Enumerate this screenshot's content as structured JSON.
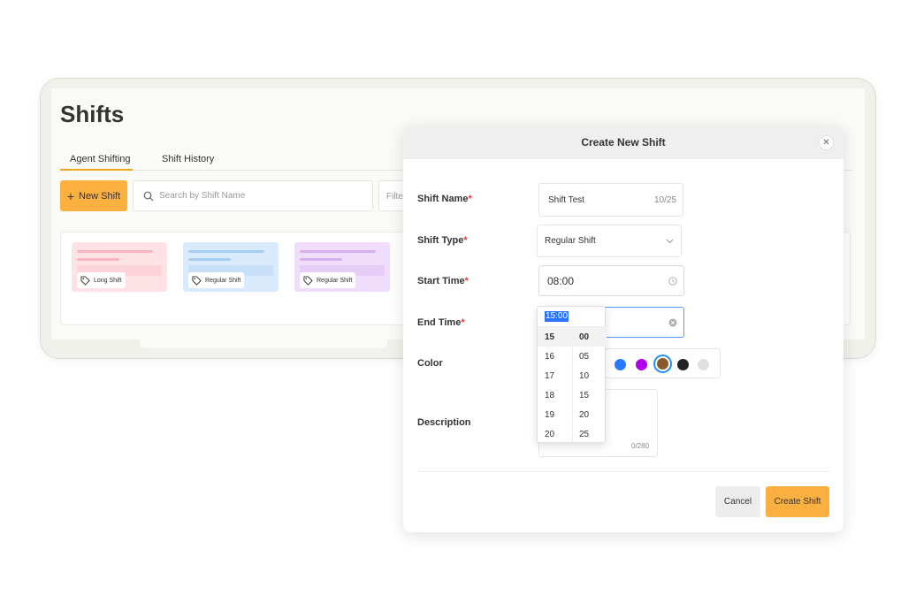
{
  "page": {
    "title": "Shifts",
    "tabs": [
      {
        "label": "Agent Shifting",
        "active": true
      },
      {
        "label": "Shift History",
        "active": false
      }
    ],
    "new_button": "New Shift",
    "search_placeholder": "Search by Shift Name",
    "filter_label": "Filter",
    "cards": [
      {
        "tag": "Long Shift",
        "color": "#ffe2e6"
      },
      {
        "tag": "Regular Shift",
        "color": "#d9eafc"
      },
      {
        "tag": "Regular Shift",
        "color": "#efddfb"
      }
    ]
  },
  "modal": {
    "title": "Create New Shift",
    "close_icon": "close-icon",
    "fields": {
      "shift_name": {
        "label": "Shift Name",
        "value": "Shift Test",
        "counter": "10/25"
      },
      "shift_type": {
        "label": "Shift Type",
        "value": "Regular Shift"
      },
      "start_time": {
        "label": "Start Time",
        "value": "08:00"
      },
      "end_time": {
        "label": "End Time",
        "value": "15:00"
      },
      "color": {
        "label": "Color",
        "swatches": [
          "#2979ff",
          "#b000f0",
          "#8a5a2b",
          "#222222",
          "#e0e0e0"
        ],
        "selected": "#8a5a2b"
      },
      "description": {
        "label": "Description",
        "value": "",
        "counter": "0/280"
      }
    },
    "required_mark": "*",
    "cancel_label": "Cancel",
    "create_label": "Create Shift"
  },
  "time_picker": {
    "selected_text": "15:00",
    "hours": [
      "15",
      "16",
      "17",
      "18",
      "19",
      "20"
    ],
    "minutes": [
      "00",
      "05",
      "10",
      "15",
      "20",
      "25"
    ],
    "selected_hour": "15",
    "selected_minute": "00"
  },
  "colors": {
    "accent": "#fbb040",
    "required": "#e53935",
    "selection": "#2b74ff"
  }
}
